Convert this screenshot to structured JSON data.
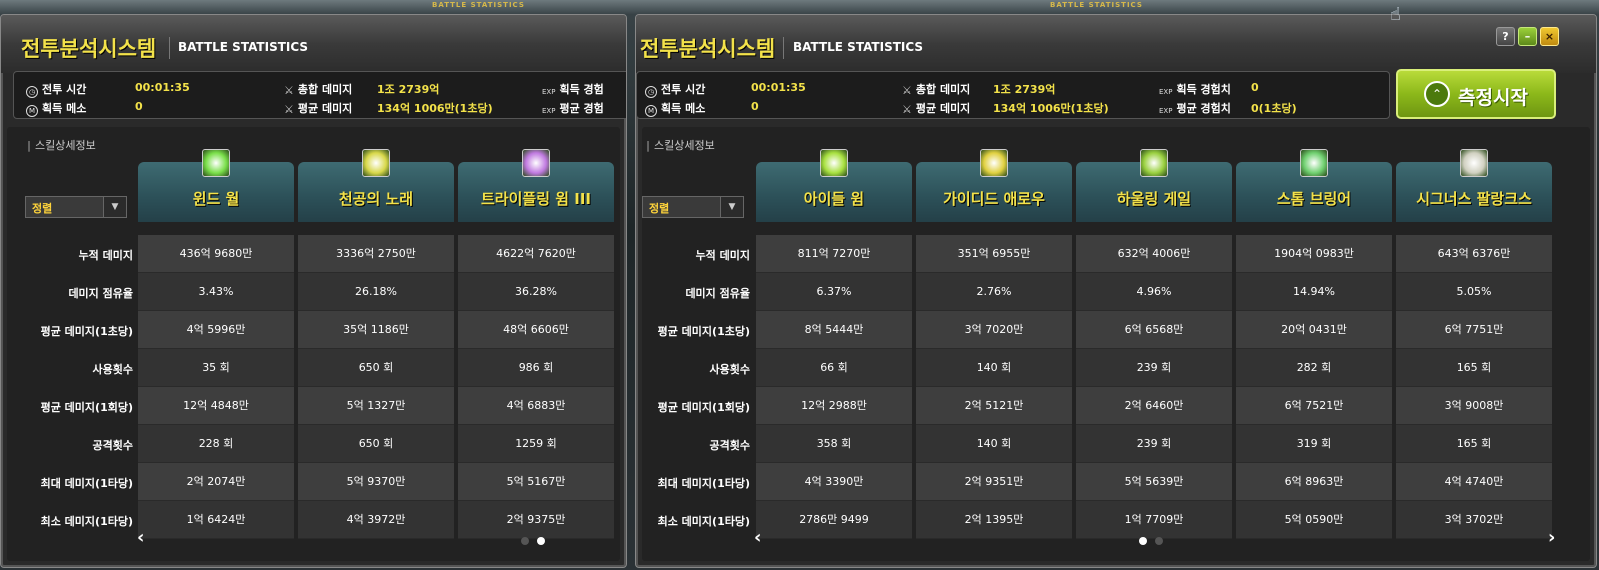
{
  "top_label": "BATTLE STATISTICS",
  "title_kr": "전투분석시스템",
  "title_en": "BATTLE STATISTICS",
  "buttons": {
    "help": "?",
    "minimize": "–",
    "close": "×",
    "start": "측정시작"
  },
  "info": {
    "battle_time": {
      "label": "전투 시간",
      "value": "00:01:35"
    },
    "meso": {
      "label": "획득 메소",
      "value": "0"
    },
    "total_damage": {
      "label": "총합 데미지",
      "value": "1조 2739억"
    },
    "avg_damage": {
      "label": "평균 데미지",
      "value": "134억 1006만(1초당)"
    },
    "exp_total": {
      "label": "획득 경험치",
      "value": "0"
    },
    "exp_avg": {
      "label": "평균 경험치",
      "value": "0(1초당)"
    },
    "exp_total_cut": "획득 경험",
    "exp_avg_cut": "평균 경험"
  },
  "section_header": "스킬상세정보",
  "sort": {
    "value": "정렬"
  },
  "row_labels": [
    "누적 데미지",
    "데미지 점유율",
    "평균 데미지(1초당)",
    "사용횟수",
    "평균 데미지(1회당)",
    "공격횟수",
    "최대 데미지(1타당)",
    "최소 데미지(1타당)"
  ],
  "window1": {
    "skills": [
      {
        "name": "윈드 월",
        "icon": "wind-wall-icon",
        "color": "#7adf4a",
        "values": [
          "436억 9680만",
          "3.43%",
          "4억 5996만",
          "35 회",
          "12억 4848만",
          "228 회",
          "2억 2074만",
          "1억 6424만"
        ]
      },
      {
        "name": "천공의 노래",
        "icon": "song-of-heaven-icon",
        "color": "#d8d84a",
        "values": [
          "3336억 2750만",
          "26.18%",
          "35억 1186만",
          "650 회",
          "5억 1327만",
          "650 회",
          "5억 9370만",
          "4억 3972만"
        ]
      },
      {
        "name": "트라이플링 윔 III",
        "icon": "trifling-whim-icon",
        "color": "#c07ae0",
        "values": [
          "4622억 7620만",
          "36.28%",
          "48억 6606만",
          "986 회",
          "4억 6883만",
          "1259 회",
          "5억 5167만",
          "2억 9375만"
        ]
      }
    ]
  },
  "window2": {
    "skills": [
      {
        "name": "아이들 윔",
        "icon": "idle-whim-icon",
        "color": "#a8e040",
        "values": [
          "811억 7270만",
          "6.37%",
          "8억 5444만",
          "66 회",
          "12억 2988만",
          "358 회",
          "4억 3390만",
          "2786만 9499"
        ]
      },
      {
        "name": "가이디드 애로우",
        "icon": "guided-arrow-icon",
        "color": "#e0d040",
        "values": [
          "351억 6955만",
          "2.76%",
          "3억 7020만",
          "140 회",
          "2억 5121만",
          "140 회",
          "2억 9351만",
          "2억 1395만"
        ]
      },
      {
        "name": "하울링 게일",
        "icon": "howling-gale-icon",
        "color": "#9ad040",
        "values": [
          "632억 4006만",
          "4.96%",
          "6억 6568만",
          "239 회",
          "2억 6460만",
          "239 회",
          "5억 5639만",
          "1억 7709만"
        ]
      },
      {
        "name": "스톰 브링어",
        "icon": "storm-bringer-icon",
        "color": "#70d070",
        "values": [
          "1904억 0983만",
          "14.94%",
          "20억 0431만",
          "282 회",
          "6억 7521만",
          "319 회",
          "6억 8963만",
          "5억 0590만"
        ]
      },
      {
        "name": "시그너스 팔랑크스",
        "icon": "cygnus-phalanx-icon",
        "color": "#d0d0c0",
        "values": [
          "643억 6376만",
          "5.05%",
          "6억 7751만",
          "165 회",
          "3억 9008만",
          "165 회",
          "4억 4740만",
          "3억 3702만"
        ]
      }
    ]
  },
  "colors": {
    "accent": "#f3e24a",
    "start_button": "#8cb81a",
    "header_teal": "#2c5058"
  }
}
